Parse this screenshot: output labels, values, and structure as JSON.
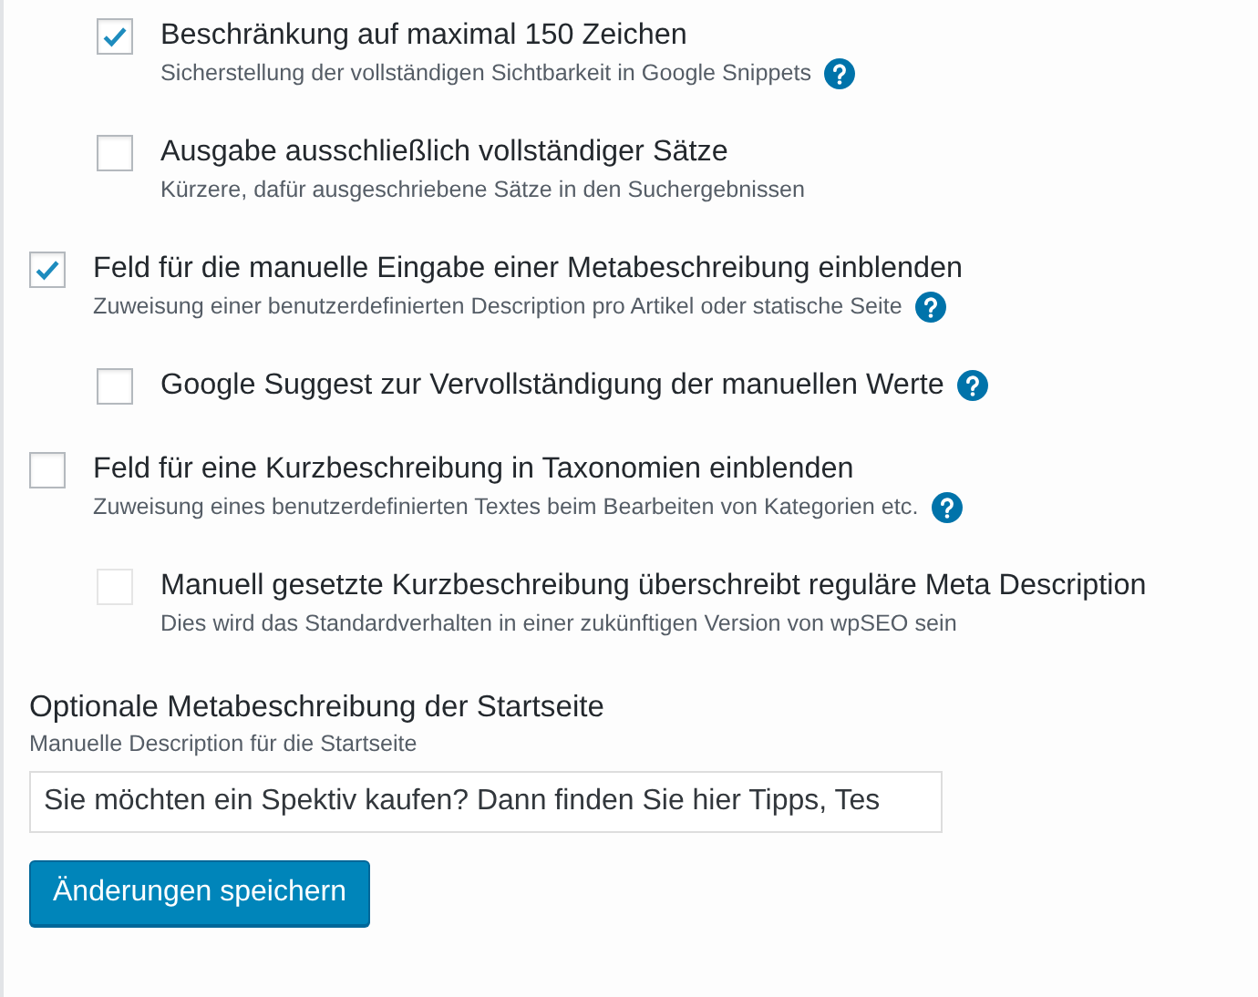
{
  "options": [
    {
      "children": [
        {
          "label": "Beschränkung auf maximal 150 Zeichen",
          "description": "Sicherstellung der vollständigen Sichtbarkeit in Google Snippets",
          "checked": true,
          "disabled": false,
          "help": true
        },
        {
          "label": "Ausgabe ausschließlich vollständiger Sätze",
          "description": "Kürzere, dafür ausgeschriebene Sätze in den Suchergebnissen",
          "checked": false,
          "disabled": false,
          "help": false
        }
      ]
    },
    {
      "label": "Feld für die manuelle Eingabe einer Metabeschreibung einblenden",
      "description": "Zuweisung einer benutzerdefinierten Description pro Artikel oder statische Seite",
      "checked": true,
      "disabled": false,
      "help": true,
      "children": [
        {
          "label": "Google Suggest zur Vervollständigung der manuellen Werte",
          "checked": false,
          "disabled": false,
          "help": true
        }
      ]
    },
    {
      "label": "Feld für eine Kurzbeschreibung in Taxonomien einblenden",
      "description": "Zuweisung eines benutzerdefinierten Textes beim Bearbeiten von Kategorien etc.",
      "checked": false,
      "disabled": false,
      "help": true,
      "children": [
        {
          "label": "Manuell gesetzte Kurzbeschreibung überschreibt reguläre Meta Description",
          "description": "Dies wird das Standardverhalten in einer zukünftigen Version von wpSEO sein",
          "checked": false,
          "disabled": true,
          "help": false
        }
      ]
    }
  ],
  "homepage_description": {
    "title": "Optionale Metabeschreibung der Startseite",
    "description": "Manuelle Description für die Startseite",
    "value": "Sie möchten ein Spektiv kaufen? Dann finden Sie hier Tipps, Tes"
  },
  "save_button": "Änderungen speichern"
}
